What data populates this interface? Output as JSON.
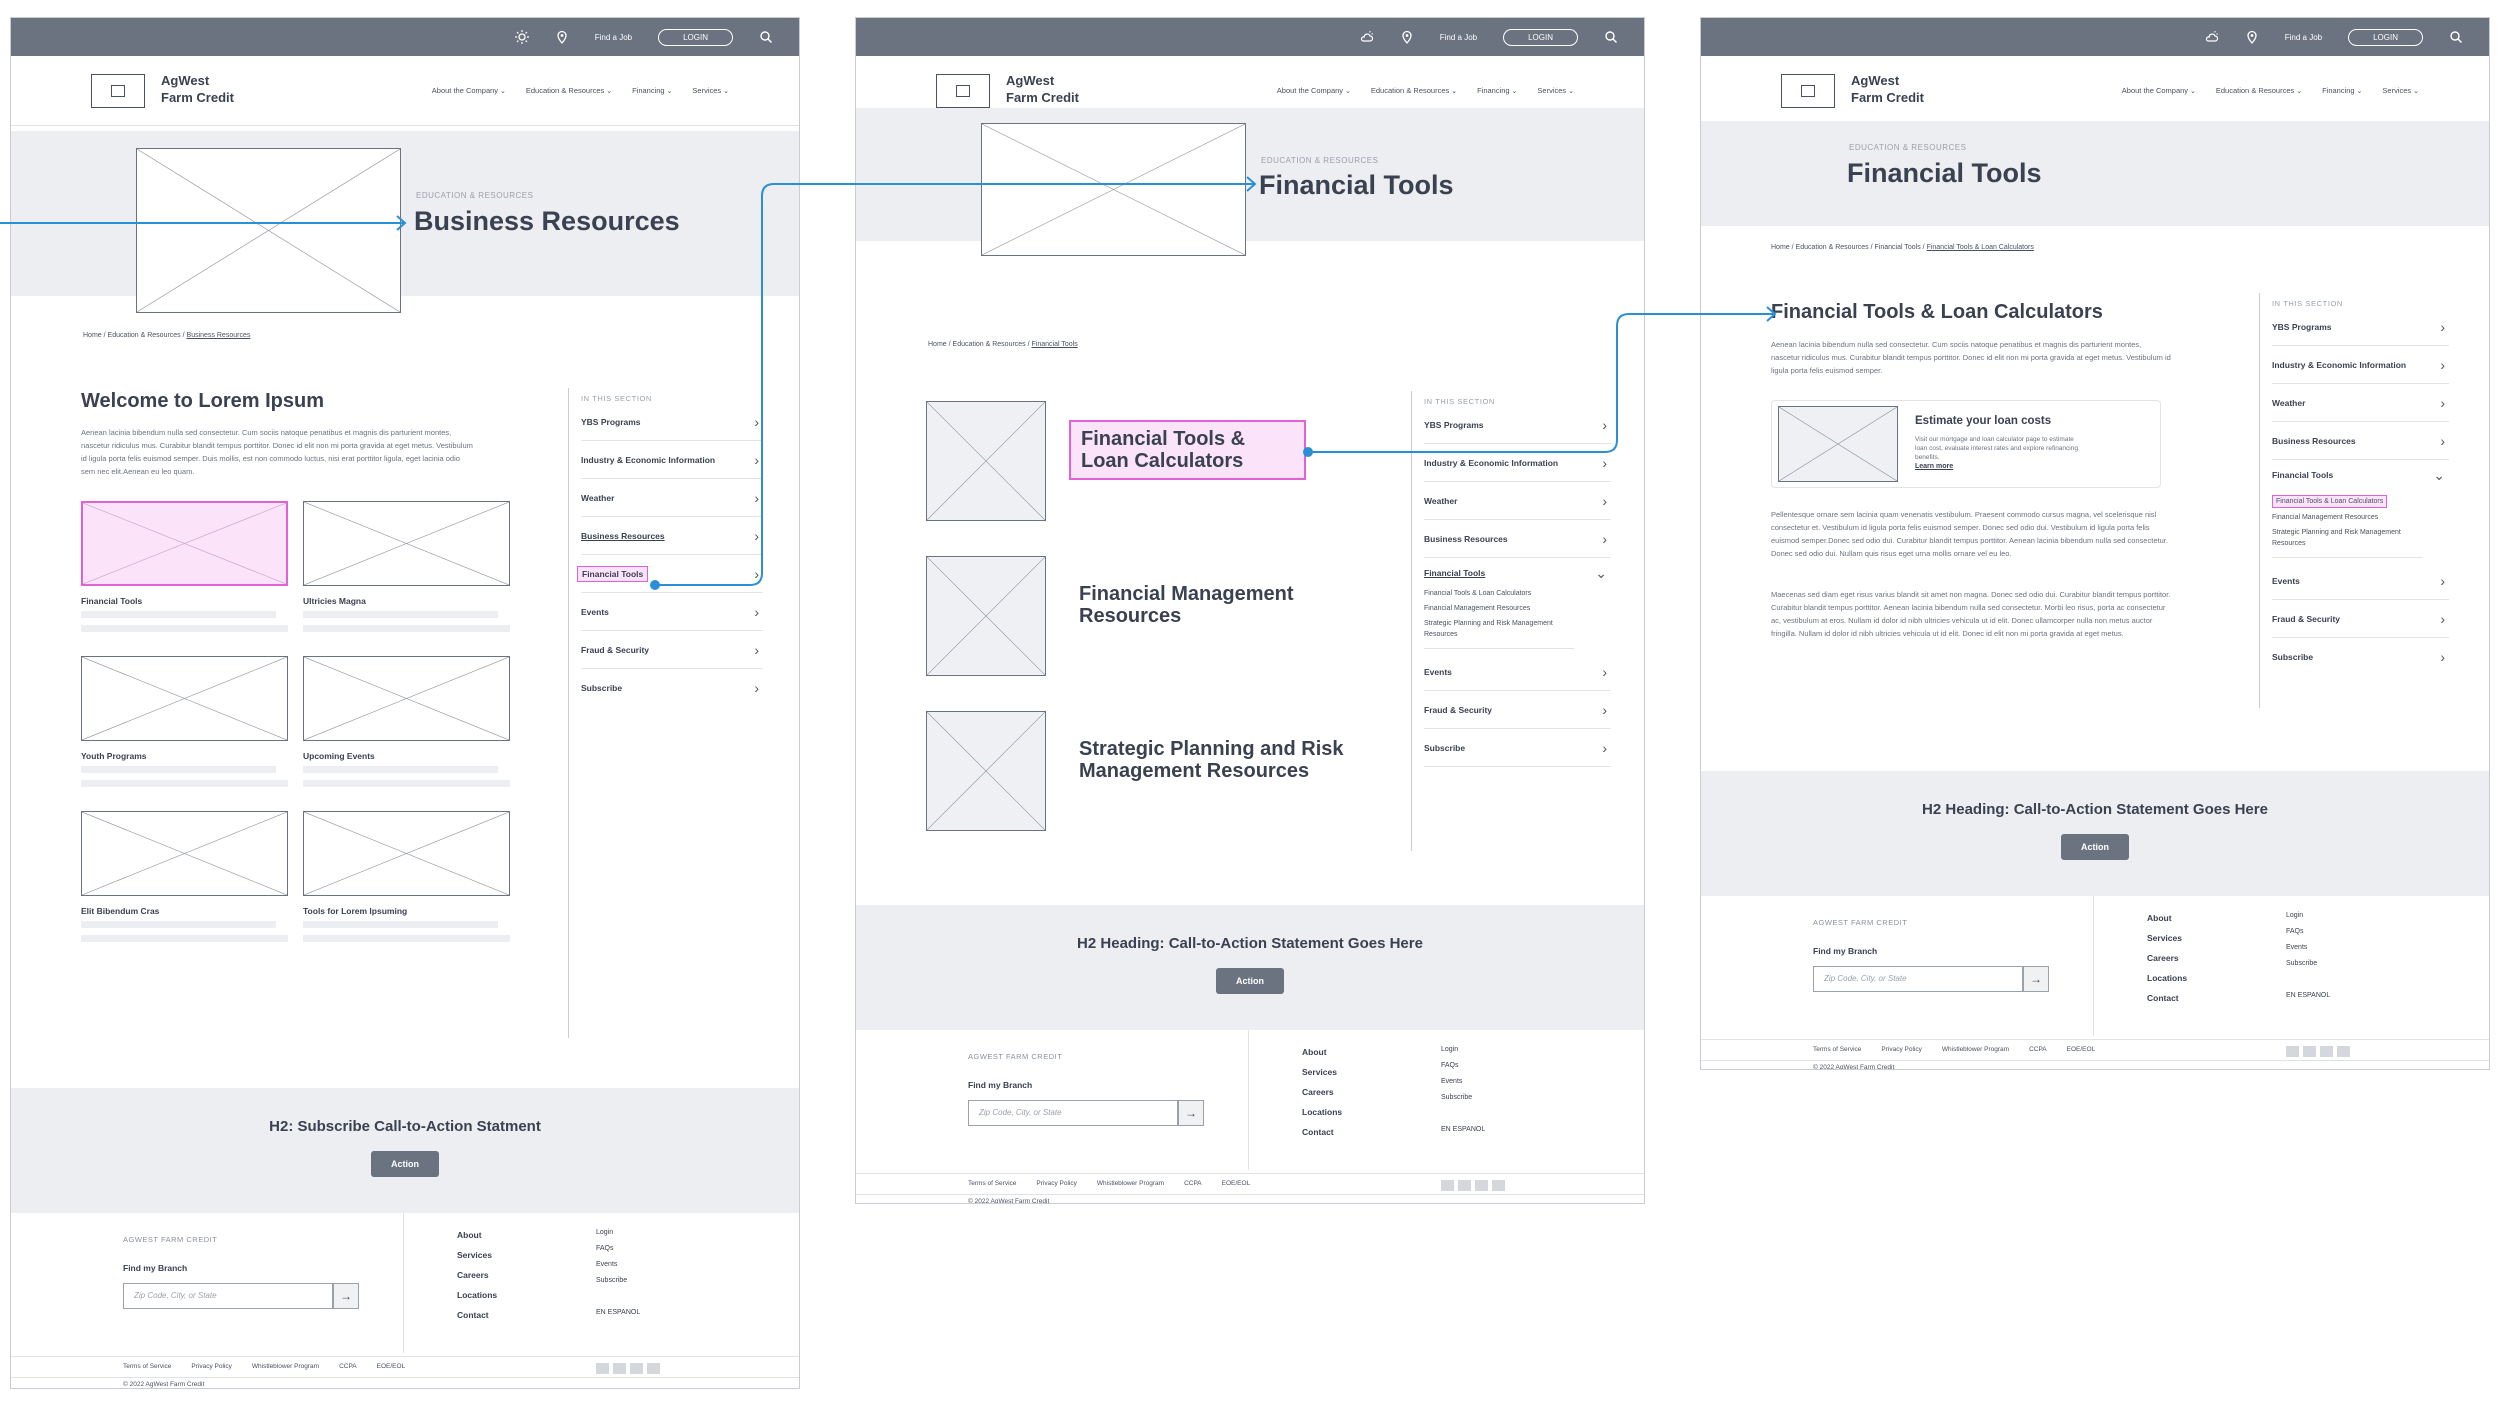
{
  "util": {
    "find_job": "Find a Job",
    "login": "LOGIN"
  },
  "brand": {
    "line1": "AgWest",
    "line2": "Farm Credit"
  },
  "nav": [
    "About the Company",
    "Education & Resources",
    "Financing",
    "Services"
  ],
  "sidebar": {
    "title": "IN THIS SECTION",
    "items": [
      "YBS Programs",
      "Industry & Economic Information",
      "Weather",
      "Business Resources",
      "Financial Tools",
      "Events",
      "Fraud & Security",
      "Subscribe"
    ],
    "subitems": [
      "Financial Tools & Loan Calculators",
      "Financial Management Resources",
      "Strategic Planning and Risk Management Resources"
    ]
  },
  "page1": {
    "eyebrow": "EDUCATION & RESOURCES",
    "title": "Business Resources",
    "crumbs": [
      "Home",
      "Education & Resources",
      "Business Resources"
    ],
    "welcome": "Welcome to Lorem Ipsum",
    "intro": "Aenean lacinia bibendum nulla sed consectetur. Cum sociis natoque penatibus et magnis dis parturient montes, nascetur ridiculus mus. Curabitur blandit tempus porttitor. Donec id elit non mi porta gravida at eget metus. Vestibulum id ligula porta felis euismod semper. Duis mollis, est non commodo luctus, nisi erat porttitor ligula, eget lacinia odio sem nec elit.Aenean eu leo quam.",
    "cards": [
      "Financial Tools",
      "Ultricies Magna",
      "Youth Programs",
      "Upcoming Events",
      "Elit Bibendum Cras",
      "Tools for Lorem Ipsuming"
    ],
    "cta": "H2: Subscribe Call-to-Action Statment",
    "action": "Action"
  },
  "page2": {
    "eyebrow": "EDUCATION & RESOURCES",
    "title": "Financial Tools",
    "crumbs": [
      "Home",
      "Education & Resources",
      "Financial Tools"
    ],
    "items": [
      "Financial Tools & Loan Calculators",
      "Financial Management Resources",
      "Strategic Planning and Risk Management Resources"
    ],
    "cta": "H2 Heading: Call-to-Action Statement Goes Here",
    "action": "Action"
  },
  "page3": {
    "eyebrow": "EDUCATION & RESOURCES",
    "title": "Financial Tools",
    "crumbs": [
      "Home",
      "Education & Resources",
      "Financial Tools",
      "Financial Tools & Loan Calculators"
    ],
    "h2": "Financial Tools & Loan Calculators",
    "p1": "Aenean lacinia bibendum nulla sed consectetur. Cum sociis natoque penatibus et magnis dis parturient montes, nascetur ridiculus mus. Curabitur blandit tempus porttitor. Donec id elit non mi porta gravida at eget metus. Vestibulum id ligula porta felis euismod semper.",
    "callout_title": "Estimate your loan costs",
    "callout_text": "Visit our mortgage and loan calculator page to estimate loan cost, evaluate interest rates and explore refinancing benefits.",
    "callout_link": "Learn more",
    "p2": "Pellentesque ornare sem lacinia quam venenatis vestibulum. Praesent commodo cursus magna, vel scelerisque nisl consectetur et. Vestibulum id ligula porta felis euismod semper. Donec sed odio dui. Vestibulum id ligula porta felis euismod semper.Donec sed odio dui. Curabitur blandit tempus porttitor. Aenean lacinia bibendum nulla sed consectetur. Donec sed odio dui. Nullam quis risus eget urna mollis ornare vel eu leo.",
    "p3": "Maecenas sed diam eget risus varius blandit sit amet non magna. Donec sed odio dui. Curabitur blandit tempus porttitor. Curabitur blandit tempus porttitor. Aenean lacinia bibendum nulla sed consectetur. Morbi leo risus, porta ac consectetur ac, vestibulum at eros. Nullam id dolor id nibh ultricies vehicula ut id elit. Donec ullamcorper nulla non metus auctor fringilla. Nullam id dolor id nibh ultricies vehicula ut id elit. Donec id elit non mi porta gravida at eget metus.",
    "cta": "H2 Heading: Call-to-Action Statement Goes Here",
    "action": "Action"
  },
  "footer": {
    "org": "AGWEST FARM CREDIT",
    "find": "Find my Branch",
    "zip_placeholder": "Zip Code, City, or State",
    "col1": [
      "About",
      "Services",
      "Careers",
      "Locations",
      "Contact"
    ],
    "col2": [
      "Login",
      "FAQs",
      "Events",
      "Subscribe"
    ],
    "lang": "EN ESPANOL",
    "legal": [
      "Terms of Service",
      "Privacy Policy",
      "Whistleblower Program",
      "CCPA",
      "EOE/EOL"
    ],
    "copyright": "© 2022 AgWest Farm Credit"
  },
  "colors": {
    "highlight": "#e062d6",
    "connector": "#2b8fd6",
    "utility_bar": "#6b7280",
    "hero_bg": "#eceef1"
  }
}
